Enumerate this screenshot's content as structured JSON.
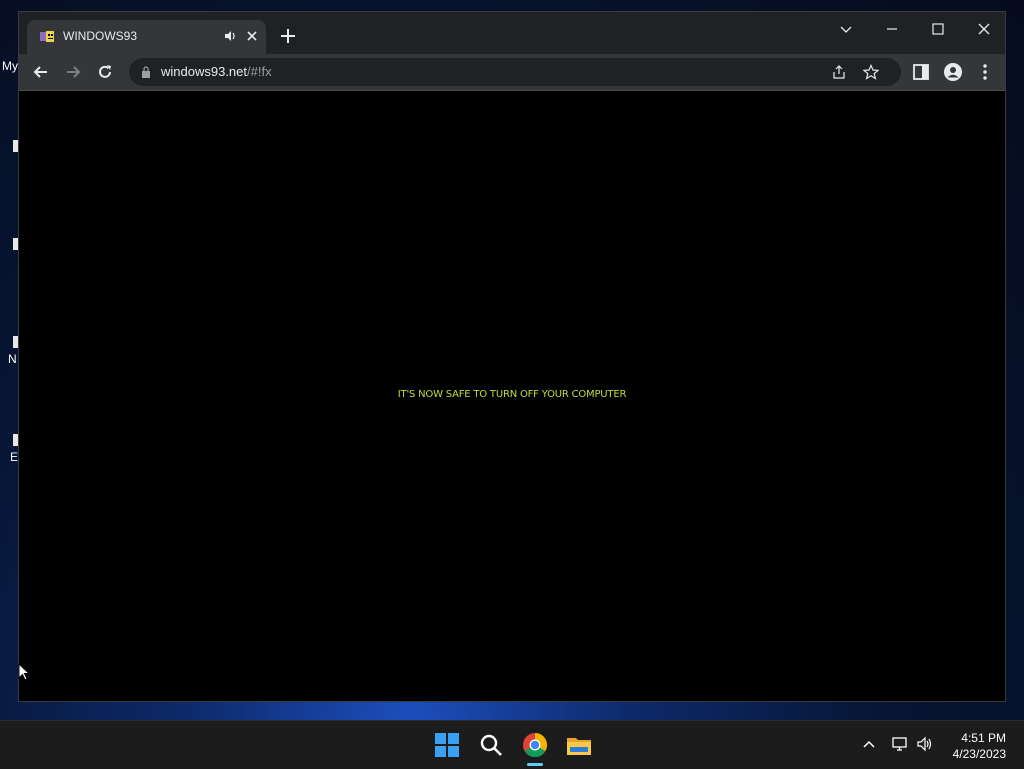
{
  "desktop": {
    "partial_labels": [
      "My",
      "N",
      "E"
    ]
  },
  "browser": {
    "tab": {
      "title": "WINDOWS93",
      "favicon": "windows93-favicon",
      "audio_icon": "speaker-icon",
      "close_icon": "close-icon"
    },
    "new_tab_icon": "plus-icon",
    "window_controls": [
      "chevron-down-icon",
      "minimize-icon",
      "maximize-icon",
      "close-icon"
    ],
    "omnibox": {
      "host": "windows93.net",
      "path": "/#!fx"
    }
  },
  "page": {
    "message": "IT'S NOW SAFE TO TURN OFF YOUR COMPUTER",
    "message_color": "#c4d93a",
    "background": "#000000"
  },
  "taskbar": {
    "apps": [
      "windows-start-icon",
      "search-icon",
      "chrome-icon",
      "file-explorer-icon"
    ],
    "active_app": "chrome-icon",
    "tray": [
      "chevron-up-icon",
      "network-icon",
      "volume-icon"
    ],
    "time": "4:51 PM",
    "date": "4/23/2023"
  }
}
